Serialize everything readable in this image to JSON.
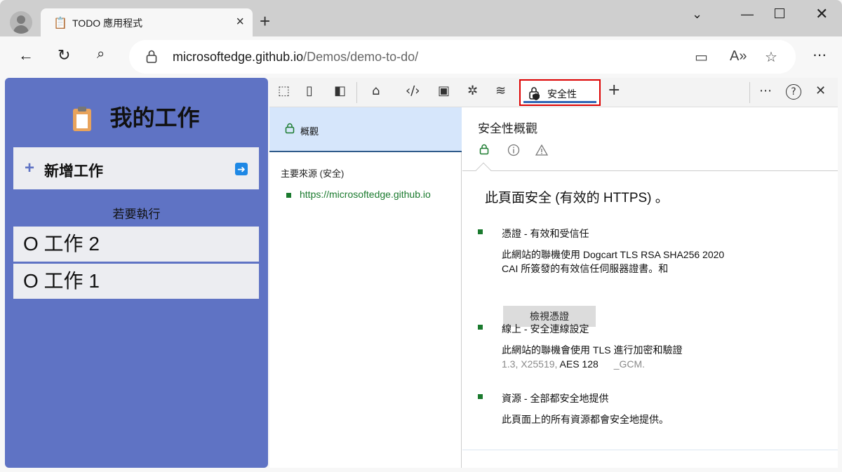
{
  "browser": {
    "tab_title": "TODO 應用程式",
    "tab_favicon": "📋",
    "url_domain": "microsoftedge.github.io",
    "url_path": "/Demos/demo-to-do/"
  },
  "todo_app": {
    "title": "我的工作",
    "add_task_label": "新增工作",
    "section_label": "若要執行",
    "tasks": [
      "O 工作 2",
      "O 工作 1"
    ]
  },
  "devtools": {
    "active_tab_label": "安全性",
    "sidebar": {
      "overview_label": "概觀",
      "main_origin_title": "主要來源 (安全)",
      "origin_url": "https://microsoftedge.github.io"
    },
    "content": {
      "title": "安全性概觀",
      "summary": "此頁面安全 (有效的 HTTPS) 。",
      "certificate": {
        "heading": "憑證 - 有效和受信任",
        "desc_line1": "此網站的聯機使用 Dogcart TLS RSA SHA256 2020",
        "desc_line2": "CAI 所簽發的有效信任伺服器證書。和",
        "button_label": "檢視憑證"
      },
      "connection": {
        "heading": "線上 - 安全連線設定",
        "desc_line1": "此網站的聯機會使用 TLS 進行加密和驗證",
        "desc_line2a": "1.3, X25519,",
        "desc_line2b": "AES 128",
        "desc_line2c": "_GCM."
      },
      "resources": {
        "heading": "資源 - 全部都安全地提供",
        "desc": "此頁面上的所有資源都會安全地提供。"
      }
    }
  },
  "colors": {
    "todo_background": "#5f73c4",
    "secure_green": "#1a7a2e",
    "highlight_red": "#dd0000",
    "selected_row": "#d6e6fb"
  }
}
